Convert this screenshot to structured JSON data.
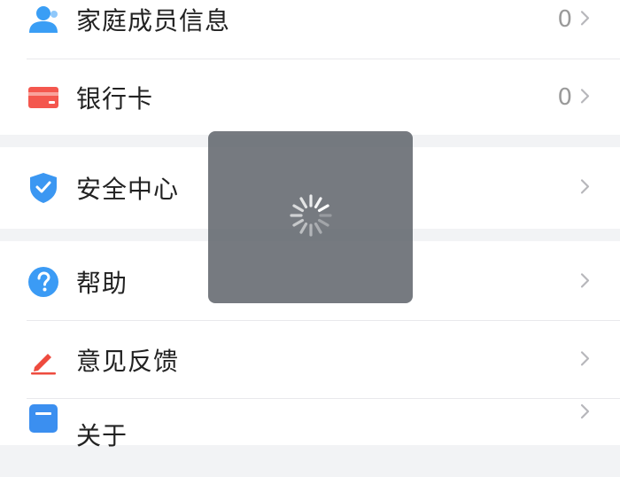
{
  "menu": {
    "family_members": {
      "label": "家庭成员信息",
      "count": "0",
      "icon": "person-icon"
    },
    "bank_card": {
      "label": "银行卡",
      "count": "0",
      "icon": "bank-card-icon"
    },
    "security_center": {
      "label": "安全中心",
      "icon": "shield-check-icon"
    },
    "help": {
      "label": "帮助",
      "icon": "question-circle-icon"
    },
    "feedback": {
      "label": "意见反馈",
      "icon": "pencil-icon"
    },
    "about": {
      "label": "关于",
      "icon": "info-card-icon"
    }
  },
  "colors": {
    "person_icon": "#3a9ef5",
    "bank_card_icon": "#f4574e",
    "shield_icon": "#3b97f2",
    "help_icon": "#3b9bf5",
    "feedback_icon": "#ee4b3e",
    "about_icon": "#3b8ff0",
    "overlay": "#60646b"
  },
  "loading": {
    "icon": "loading-spinner-icon"
  }
}
